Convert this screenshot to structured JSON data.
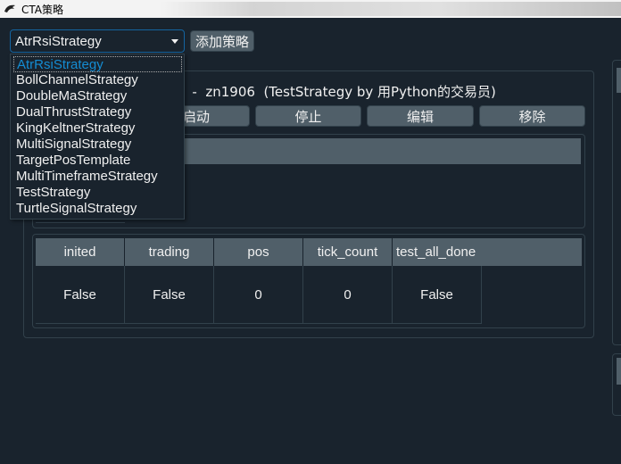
{
  "window": {
    "title": "CTA策略"
  },
  "toolbar": {
    "selected_strategy": "AtrRsiStrategy",
    "add_label": "添加策略"
  },
  "dropdown": {
    "options": [
      "AtrRsiStrategy",
      "BollChannelStrategy",
      "DoubleMaStrategy",
      "DualThrustStrategy",
      "KingKeltnerStrategy",
      "MultiSignalStrategy",
      "TargetPosTemplate",
      "MultiTimeframeStrategy",
      "TestStrategy",
      "TurtleSignalStrategy"
    ]
  },
  "strategy_card": {
    "name_visible": "t  -  zn1906  (TestStrategy by 用Python的交易员)",
    "buttons": {
      "start": "启动",
      "stop": "停止",
      "edit": "编辑",
      "remove": "移除"
    }
  },
  "variables_table": {
    "headers": [
      "inited",
      "trading",
      "pos",
      "tick_count",
      "test_all_done"
    ],
    "values": [
      "False",
      "False",
      "0",
      "0",
      "False"
    ]
  },
  "colors": {
    "background": "#19232d",
    "button": "#505f69",
    "border": "#32414b",
    "focus": "#1464a0",
    "selected_text": "#148cd2"
  }
}
